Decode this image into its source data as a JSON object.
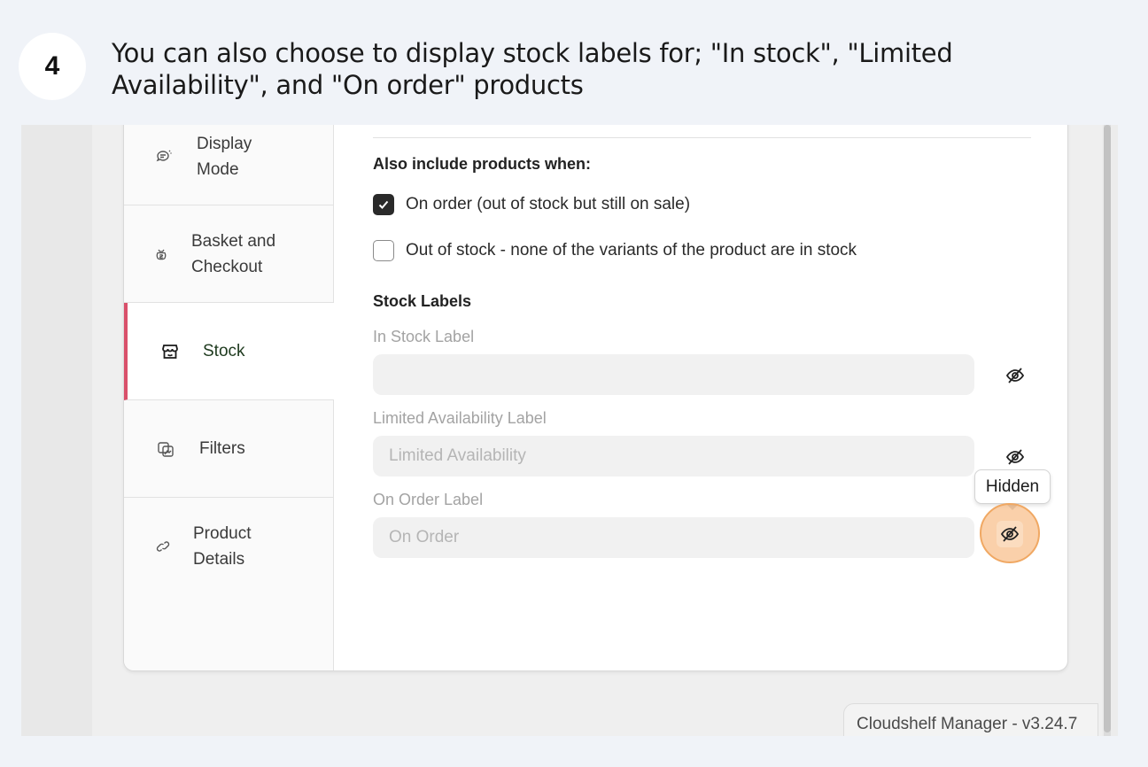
{
  "step": {
    "number": "4",
    "instruction": "You can also choose to display stock labels for; \"In stock\", \"Limited Availability\", and \"On order\" products"
  },
  "sidebar": {
    "items": [
      {
        "label": "Display Mode",
        "icon": "display-mode-icon"
      },
      {
        "label": "Basket and Checkout",
        "icon": "basket-icon"
      },
      {
        "label": "Stock",
        "icon": "store-icon",
        "active": true
      },
      {
        "label": "Filters",
        "icon": "filters-icon"
      },
      {
        "label": "Product Details",
        "icon": "link-icon"
      }
    ]
  },
  "include": {
    "title": "Also include products when:",
    "options": [
      {
        "label": "On order (out of stock but still on sale)",
        "checked": true
      },
      {
        "label": "Out of stock - none of the variants of the product are in stock",
        "checked": false
      }
    ]
  },
  "stock_labels": {
    "title": "Stock Labels",
    "fields": [
      {
        "label": "In Stock Label",
        "value": "",
        "placeholder": "",
        "visibility_icon": "eye-off-icon"
      },
      {
        "label": "Limited Availability Label",
        "value": "",
        "placeholder": "Limited Availability",
        "visibility_icon": "eye-off-icon"
      },
      {
        "label": "On Order Label",
        "value": "",
        "placeholder": "On Order",
        "visibility_icon": "eye-off-icon"
      }
    ]
  },
  "tooltip": {
    "text": "Hidden"
  },
  "footer": {
    "version": "Cloudshelf Manager - v3.24.7"
  },
  "colors": {
    "active_accent": "#d9506a",
    "highlight": "#f0a863",
    "page_bg": "#f0f3f8"
  }
}
